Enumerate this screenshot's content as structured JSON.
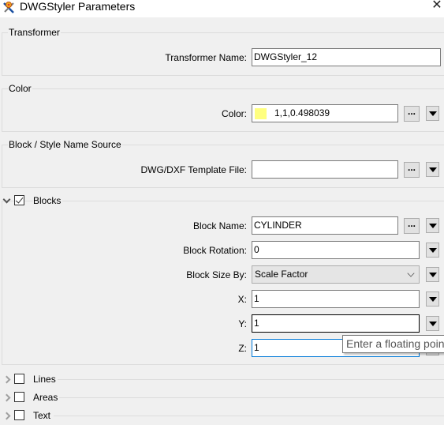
{
  "window": {
    "title": "DWGStyler Parameters",
    "close_icon": "close-icon",
    "app_icon": "fme-transformer-icon"
  },
  "transformer": {
    "legend": "Transformer",
    "name_label": "Transformer Name:",
    "name_value": "DWGStyler_12"
  },
  "color": {
    "legend": "Color",
    "color_label": "Color:",
    "color_value": "1,1,0.498039",
    "swatch_hex": "#ffff7f",
    "browse_label": "..."
  },
  "source": {
    "legend": "Block / Style Name Source",
    "template_label": "DWG/DXF Template File:",
    "template_value": "",
    "browse_label": "..."
  },
  "blocks": {
    "title": "Blocks",
    "checked": true,
    "expanded": true,
    "block_name_label": "Block Name:",
    "block_name_value": "CYLINDER",
    "browse_label": "...",
    "rotation_label": "Block Rotation:",
    "rotation_value": "0",
    "size_by_label": "Block Size By:",
    "size_by_value": "Scale Factor",
    "x_label": "X:",
    "x_value": "1",
    "y_label": "Y:",
    "y_value": "1",
    "z_label": "Z:",
    "z_value": "1"
  },
  "collapsed_sections": [
    {
      "title": "Lines",
      "checked": false
    },
    {
      "title": "Areas",
      "checked": false
    },
    {
      "title": "Text",
      "checked": false
    }
  ],
  "tooltip": {
    "text": "Enter a floating point"
  }
}
